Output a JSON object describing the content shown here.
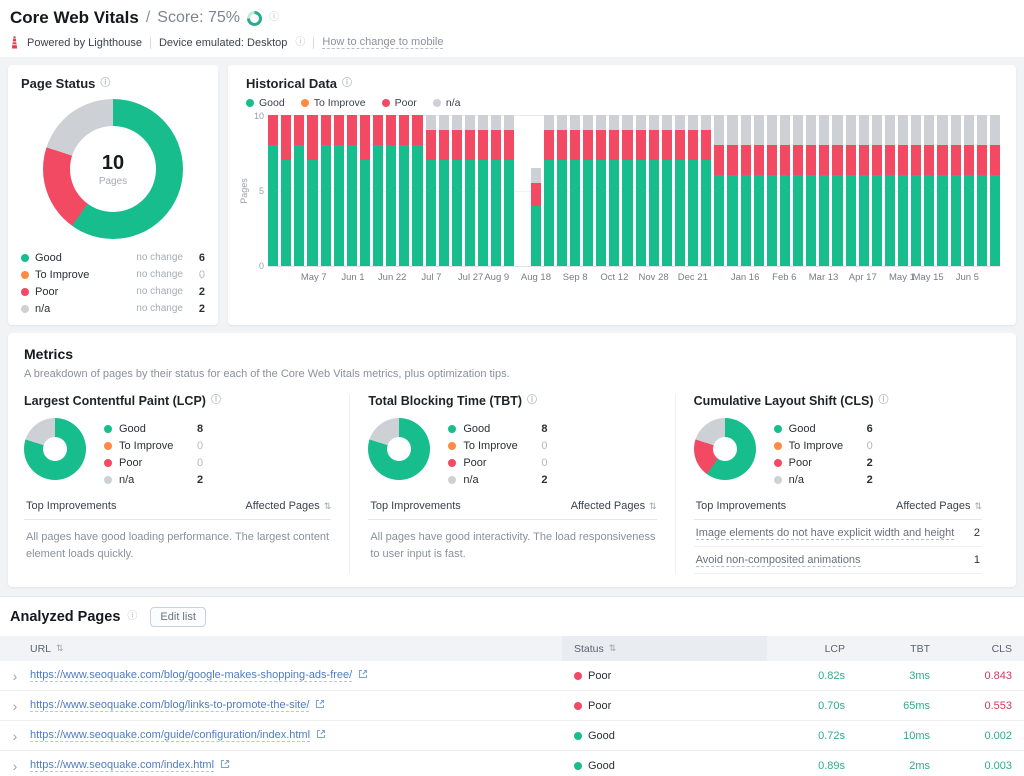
{
  "header": {
    "title": "Core Web Vitals",
    "separator": "/",
    "score_label": "Score: 75%",
    "score_percent": 75,
    "powered_by": "Powered by Lighthouse",
    "device": "Device emulated: Desktop",
    "change_link": "How to change to mobile"
  },
  "icons": {
    "info": "ⓘ",
    "sort": "⇅",
    "chevron": "›"
  },
  "colors": {
    "good": "#17bd8d",
    "to_improve": "#ff8a43",
    "poor": "#f24a63",
    "na": "#cdd0d5",
    "value_good": "#2fab8c",
    "value_bad": "#cf3a5f",
    "link": "#4f7cc0"
  },
  "page_status": {
    "title": "Page Status",
    "center_value": "10",
    "center_label": "Pages",
    "legend": [
      {
        "label": "Good",
        "change": "no change",
        "value": 6,
        "color_key": "good"
      },
      {
        "label": "To Improve",
        "change": "no change",
        "value": 0,
        "color_key": "to_improve"
      },
      {
        "label": "Poor",
        "change": "no change",
        "value": 2,
        "color_key": "poor"
      },
      {
        "label": "n/a",
        "change": "no change",
        "value": 2,
        "color_key": "na"
      }
    ]
  },
  "chart_data": [
    {
      "id": "page_status_donut",
      "type": "pie",
      "labels": [
        "Good",
        "To Improve",
        "Poor",
        "n/a"
      ],
      "values": [
        6,
        0,
        2,
        2
      ],
      "center": "10 Pages"
    },
    {
      "id": "historical",
      "type": "stacked-bar",
      "title": "Historical Data",
      "legend": [
        "Good",
        "To Improve",
        "Poor",
        "n/a"
      ],
      "ylabel": "Pages",
      "ylim": [
        0,
        10
      ],
      "yticks": [
        "0",
        "5",
        "10"
      ],
      "series_order": [
        "good",
        "to_improve",
        "poor",
        "na"
      ],
      "n_slots": 56,
      "bars": [
        [
          8,
          0,
          2,
          0
        ],
        [
          7,
          0,
          3,
          0
        ],
        [
          8,
          0,
          2,
          0
        ],
        [
          7,
          0,
          3,
          0
        ],
        [
          8,
          0,
          2,
          0
        ],
        [
          8,
          0,
          2,
          0
        ],
        [
          8,
          0,
          2,
          0
        ],
        [
          7,
          0,
          3,
          0
        ],
        [
          8,
          0,
          2,
          0
        ],
        [
          8,
          0,
          2,
          0
        ],
        [
          8,
          0,
          2,
          0
        ],
        [
          8,
          0,
          2,
          0
        ],
        [
          7,
          0,
          2,
          1
        ],
        [
          7,
          0,
          2,
          1
        ],
        [
          7,
          0,
          2,
          1
        ],
        [
          7,
          0,
          2,
          1
        ],
        [
          7,
          0,
          2,
          1
        ],
        [
          7,
          0,
          2,
          1
        ],
        [
          7,
          0,
          2,
          1
        ],
        [
          0,
          0,
          0,
          0
        ],
        [
          4,
          0,
          1.5,
          1
        ],
        [
          7,
          0,
          2,
          1
        ],
        [
          7,
          0,
          2,
          1
        ],
        [
          7,
          0,
          2,
          1
        ],
        [
          7,
          0,
          2,
          1
        ],
        [
          7,
          0,
          2,
          1
        ],
        [
          7,
          0,
          2,
          1
        ],
        [
          7,
          0,
          2,
          1
        ],
        [
          7,
          0,
          2,
          1
        ],
        [
          7,
          0,
          2,
          1
        ],
        [
          7,
          0,
          2,
          1
        ],
        [
          7,
          0,
          2,
          1
        ],
        [
          7,
          0,
          2,
          1
        ],
        [
          7,
          0,
          2,
          1
        ],
        [
          6,
          0,
          2,
          2
        ],
        [
          6,
          0,
          2,
          2
        ],
        [
          6,
          0,
          2,
          2
        ],
        [
          6,
          0,
          2,
          2
        ],
        [
          6,
          0,
          2,
          2
        ],
        [
          6,
          0,
          2,
          2
        ],
        [
          6,
          0,
          2,
          2
        ],
        [
          6,
          0,
          2,
          2
        ],
        [
          6,
          0,
          2,
          2
        ],
        [
          6,
          0,
          2,
          2
        ],
        [
          6,
          0,
          2,
          2
        ],
        [
          6,
          0,
          2,
          2
        ],
        [
          6,
          0,
          2,
          2
        ],
        [
          6,
          0,
          2,
          2
        ],
        [
          6,
          0,
          2,
          2
        ],
        [
          6,
          0,
          2,
          2
        ],
        [
          6,
          0,
          2,
          2
        ],
        [
          6,
          0,
          2,
          2
        ],
        [
          6,
          0,
          2,
          2
        ],
        [
          6,
          0,
          2,
          2
        ],
        [
          6,
          0,
          2,
          2
        ],
        [
          6,
          0,
          2,
          2
        ]
      ],
      "x_tick_labels": [
        {
          "label": "May 7",
          "index": 3
        },
        {
          "label": "Jun 1",
          "index": 6
        },
        {
          "label": "Jun 22",
          "index": 9
        },
        {
          "label": "Jul 7",
          "index": 12
        },
        {
          "label": "Jul 27",
          "index": 15
        },
        {
          "label": "Aug 9",
          "index": 17
        },
        {
          "label": "Aug 18",
          "index": 20
        },
        {
          "label": "Sep 8",
          "index": 23
        },
        {
          "label": "Oct 12",
          "index": 26
        },
        {
          "label": "Nov 28",
          "index": 29
        },
        {
          "label": "Dec 21",
          "index": 32
        },
        {
          "label": "Jan 16",
          "index": 36
        },
        {
          "label": "Feb 6",
          "index": 39
        },
        {
          "label": "Mar 13",
          "index": 42
        },
        {
          "label": "Apr 17",
          "index": 45
        },
        {
          "label": "May 1",
          "index": 48
        },
        {
          "label": "May 15",
          "index": 50
        },
        {
          "label": "Jun 5",
          "index": 53
        }
      ]
    },
    {
      "id": "lcp_donut",
      "type": "pie",
      "labels": [
        "Good",
        "To Improve",
        "Poor",
        "n/a"
      ],
      "values": [
        8,
        0,
        0,
        2
      ]
    },
    {
      "id": "tbt_donut",
      "type": "pie",
      "labels": [
        "Good",
        "To Improve",
        "Poor",
        "n/a"
      ],
      "values": [
        8,
        0,
        0,
        2
      ]
    },
    {
      "id": "cls_donut",
      "type": "pie",
      "labels": [
        "Good",
        "To Improve",
        "Poor",
        "n/a"
      ],
      "values": [
        6,
        0,
        2,
        2
      ]
    }
  ],
  "historical": {
    "title": "Historical Data"
  },
  "metrics": {
    "title": "Metrics",
    "subtitle": "A breakdown of pages by their status for each of the Core Web Vitals metrics, plus optimization tips.",
    "improvements_header": {
      "left": "Top Improvements",
      "right": "Affected Pages"
    },
    "cards": [
      {
        "title": "Largest Contentful Paint (LCP)",
        "donut_id": "lcp_donut",
        "legend": [
          {
            "label": "Good",
            "value": 8,
            "color_key": "good"
          },
          {
            "label": "To Improve",
            "value": 0,
            "color_key": "to_improve"
          },
          {
            "label": "Poor",
            "value": 0,
            "color_key": "poor"
          },
          {
            "label": "n/a",
            "value": 2,
            "color_key": "na"
          }
        ],
        "improvements": [],
        "note": "All pages have good loading performance. The largest content element loads quickly."
      },
      {
        "title": "Total Blocking Time (TBT)",
        "donut_id": "tbt_donut",
        "legend": [
          {
            "label": "Good",
            "value": 8,
            "color_key": "good"
          },
          {
            "label": "To Improve",
            "value": 0,
            "color_key": "to_improve"
          },
          {
            "label": "Poor",
            "value": 0,
            "color_key": "poor"
          },
          {
            "label": "n/a",
            "value": 2,
            "color_key": "na"
          }
        ],
        "improvements": [],
        "note": "All pages have good interactivity. The load responsiveness to user input is fast."
      },
      {
        "title": "Cumulative Layout Shift (CLS)",
        "donut_id": "cls_donut",
        "legend": [
          {
            "label": "Good",
            "value": 6,
            "color_key": "good"
          },
          {
            "label": "To Improve",
            "value": 0,
            "color_key": "to_improve"
          },
          {
            "label": "Poor",
            "value": 2,
            "color_key": "poor"
          },
          {
            "label": "n/a",
            "value": 2,
            "color_key": "na"
          }
        ],
        "improvements": [
          {
            "label": "Image elements do not have explicit width and height",
            "pages": 2
          },
          {
            "label": "Avoid non-composited animations",
            "pages": 1
          }
        ],
        "note": ""
      }
    ]
  },
  "analyzed_pages": {
    "title": "Analyzed Pages",
    "edit_button": "Edit list",
    "columns": [
      "URL",
      "Status",
      "LCP",
      "TBT",
      "CLS"
    ],
    "rows": [
      {
        "url": "https://www.seoquake.com/blog/google-makes-shopping-ads-free/",
        "status": "Poor",
        "status_key": "poor",
        "lcp": "0.82s",
        "tbt": "3ms",
        "cls": "0.843",
        "cls_bad": true
      },
      {
        "url": "https://www.seoquake.com/blog/links-to-promote-the-site/",
        "status": "Poor",
        "status_key": "poor",
        "lcp": "0.70s",
        "tbt": "65ms",
        "cls": "0.553",
        "cls_bad": true
      },
      {
        "url": "https://www.seoquake.com/guide/configuration/index.html",
        "status": "Good",
        "status_key": "good",
        "lcp": "0.72s",
        "tbt": "10ms",
        "cls": "0.002",
        "cls_bad": false
      },
      {
        "url": "https://www.seoquake.com/index.html",
        "status": "Good",
        "status_key": "good",
        "lcp": "0.89s",
        "tbt": "2ms",
        "cls": "0.003",
        "cls_bad": false
      }
    ]
  }
}
